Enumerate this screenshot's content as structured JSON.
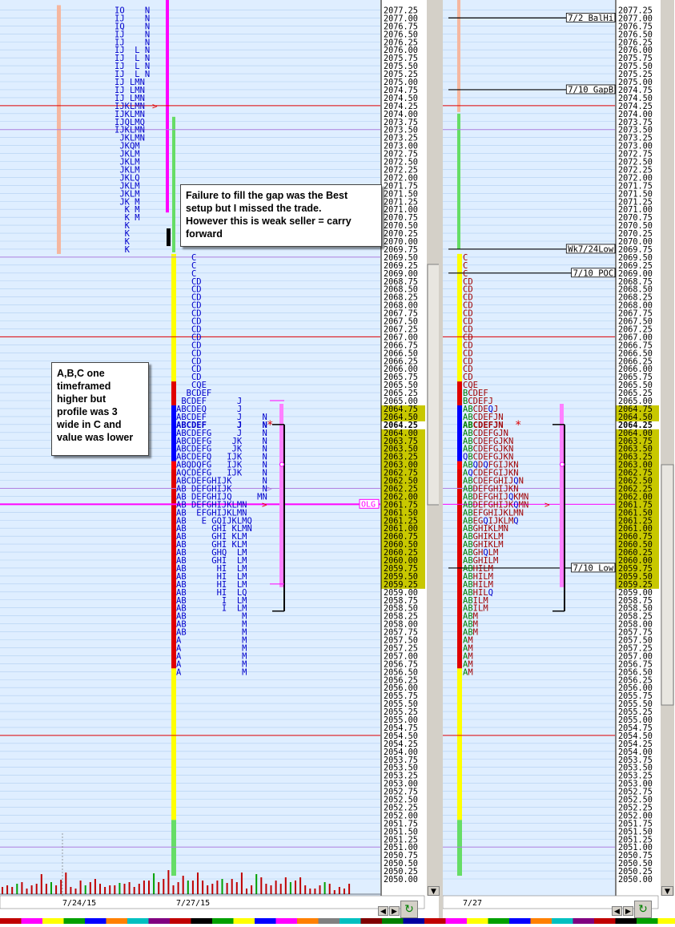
{
  "chart_data": {
    "type": "market-profile",
    "price_axis": {
      "min": 2050.0,
      "max": 2077.25,
      "tick": 0.25,
      "highlight": 2064.25,
      "value_area": [
        2059.25,
        2064.75
      ]
    },
    "left_panel": {
      "date_labels": [
        "7/24/15",
        "7/27/15"
      ],
      "overlay_label": "OLG",
      "prior_day_profile": [
        {
          "p": 2077.25,
          "s": "IO    N"
        },
        {
          "p": 2077.0,
          "s": "IJ    N"
        },
        {
          "p": 2076.75,
          "s": "IQ    N"
        },
        {
          "p": 2076.5,
          "s": "IJ    N"
        },
        {
          "p": 2076.25,
          "s": "IJ    N"
        },
        {
          "p": 2076.0,
          "s": "IJ  L N"
        },
        {
          "p": 2075.75,
          "s": "IJ  L N"
        },
        {
          "p": 2075.5,
          "s": "IJ  L N"
        },
        {
          "p": 2075.25,
          "s": "IJ  L N"
        },
        {
          "p": 2075.0,
          "s": "IJ LMN"
        },
        {
          "p": 2074.75,
          "s": "IJ LMN"
        },
        {
          "p": 2074.5,
          "s": "IJ LMN"
        },
        {
          "p": 2074.25,
          "s": "IJKLMN"
        },
        {
          "p": 2074.0,
          "s": "IJKLMN"
        },
        {
          "p": 2073.75,
          "s": "IJQLMQ"
        },
        {
          "p": 2073.5,
          "s": "IJKLMN"
        },
        {
          "p": 2073.25,
          "s": " JKLMN"
        },
        {
          "p": 2073.0,
          "s": " JKQM"
        },
        {
          "p": 2072.75,
          "s": " JKLM"
        },
        {
          "p": 2072.5,
          "s": " JKLM"
        },
        {
          "p": 2072.25,
          "s": " JKLM"
        },
        {
          "p": 2072.0,
          "s": " JKLQ"
        },
        {
          "p": 2071.75,
          "s": " JKLM"
        },
        {
          "p": 2071.5,
          "s": " JKLM"
        },
        {
          "p": 2071.25,
          "s": " JK M"
        },
        {
          "p": 2071.0,
          "s": "  K M"
        },
        {
          "p": 2070.75,
          "s": "  K M"
        },
        {
          "p": 2070.5,
          "s": "  K"
        },
        {
          "p": 2070.25,
          "s": "  K"
        },
        {
          "p": 2070.0,
          "s": "  K"
        },
        {
          "p": 2069.75,
          "s": "  K"
        }
      ],
      "profile": [
        {
          "p": 2069.5,
          "s": "   C"
        },
        {
          "p": 2069.25,
          "s": "   C"
        },
        {
          "p": 2069.0,
          "s": "   C"
        },
        {
          "p": 2068.75,
          "s": "   CD"
        },
        {
          "p": 2068.5,
          "s": "   CD"
        },
        {
          "p": 2068.25,
          "s": "   CD"
        },
        {
          "p": 2068.0,
          "s": "   CD"
        },
        {
          "p": 2067.75,
          "s": "   CD"
        },
        {
          "p": 2067.5,
          "s": "   CD"
        },
        {
          "p": 2067.25,
          "s": "   CD"
        },
        {
          "p": 2067.0,
          "s": "   CD"
        },
        {
          "p": 2066.75,
          "s": "   CD"
        },
        {
          "p": 2066.5,
          "s": "   CD"
        },
        {
          "p": 2066.25,
          "s": "   CD"
        },
        {
          "p": 2066.0,
          "s": "   CD"
        },
        {
          "p": 2065.75,
          "s": "   CD"
        },
        {
          "p": 2065.5,
          "s": "   CQE"
        },
        {
          "p": 2065.25,
          "s": "  BCDEF"
        },
        {
          "p": 2065.0,
          "s": " BCDEF      J"
        },
        {
          "p": 2064.75,
          "s": "ABCDEQ      J"
        },
        {
          "p": 2064.5,
          "s": "ABCDEF      J    N"
        },
        {
          "p": 2064.25,
          "s": "ABCDEF      J    N"
        },
        {
          "p": 2064.0,
          "s": "ABCDEFG     J    N"
        },
        {
          "p": 2063.75,
          "s": "ABCDEFG    JK    N"
        },
        {
          "p": 2063.5,
          "s": "ABCDEFG    JK    N"
        },
        {
          "p": 2063.25,
          "s": "ABCDEFQ   IJK    N"
        },
        {
          "p": 2063.0,
          "s": "ABQDQFG   IJK    N"
        },
        {
          "p": 2062.75,
          "s": "AQCDEFG   IJK    N"
        },
        {
          "p": 2062.5,
          "s": "ABCDEFGHIJK      N"
        },
        {
          "p": 2062.25,
          "s": "AB DEFGHIJK      N"
        },
        {
          "p": 2062.0,
          "s": "AB DEFGHIJQ     MN"
        },
        {
          "p": 2061.75,
          "s": "AB DEFGHIJKLMN"
        },
        {
          "p": 2061.5,
          "s": "AB  EFGHIJKLMN"
        },
        {
          "p": 2061.25,
          "s": "AB   E GQIJKLMQ"
        },
        {
          "p": 2061.0,
          "s": "AB     GHI KLMN"
        },
        {
          "p": 2060.75,
          "s": "AB     GHI KLM"
        },
        {
          "p": 2060.5,
          "s": "AB     GHI KLM"
        },
        {
          "p": 2060.25,
          "s": "AB     GHQ  LM"
        },
        {
          "p": 2060.0,
          "s": "AB     GHI  LM"
        },
        {
          "p": 2059.75,
          "s": "AB      HI  LM"
        },
        {
          "p": 2059.5,
          "s": "AB      HI  LM"
        },
        {
          "p": 2059.25,
          "s": "AB      HI  LM"
        },
        {
          "p": 2059.0,
          "s": "AB      HI  LQ"
        },
        {
          "p": 2058.75,
          "s": "AB       I  LM"
        },
        {
          "p": 2058.5,
          "s": "AB       I  LM"
        },
        {
          "p": 2058.25,
          "s": "AB           M"
        },
        {
          "p": 2058.0,
          "s": "AB           M"
        },
        {
          "p": 2057.75,
          "s": "AB           M"
        },
        {
          "p": 2057.5,
          "s": "A            M"
        },
        {
          "p": 2057.25,
          "s": "A            M"
        },
        {
          "p": 2057.0,
          "s": "A            M"
        },
        {
          "p": 2056.75,
          "s": "A            M"
        },
        {
          "p": 2056.5,
          "s": "A            M"
        }
      ]
    },
    "right_panel": {
      "date_labels": [
        "7/27"
      ],
      "reference_labels": [
        {
          "p": 2077.0,
          "t": "7/2 BalHi"
        },
        {
          "p": 2074.75,
          "t": "7/10 GapB"
        },
        {
          "p": 2069.75,
          "t": "Wk7/24Low"
        },
        {
          "p": 2069.0,
          "t": "7/10 POC"
        },
        {
          "p": 2059.75,
          "t": "7/10 Low"
        }
      ],
      "profile": [
        {
          "p": 2069.5,
          "s": "C"
        },
        {
          "p": 2069.25,
          "s": "C"
        },
        {
          "p": 2069.0,
          "s": "C"
        },
        {
          "p": 2068.75,
          "s": "CD"
        },
        {
          "p": 2068.5,
          "s": "CD"
        },
        {
          "p": 2068.25,
          "s": "CD"
        },
        {
          "p": 2068.0,
          "s": "CD"
        },
        {
          "p": 2067.75,
          "s": "CD"
        },
        {
          "p": 2067.5,
          "s": "CD"
        },
        {
          "p": 2067.25,
          "s": "CD"
        },
        {
          "p": 2067.0,
          "s": "CD"
        },
        {
          "p": 2066.75,
          "s": "CD"
        },
        {
          "p": 2066.5,
          "s": "CD"
        },
        {
          "p": 2066.25,
          "s": "CD"
        },
        {
          "p": 2066.0,
          "s": "CD"
        },
        {
          "p": 2065.75,
          "s": "CD"
        },
        {
          "p": 2065.5,
          "s": "CQE"
        },
        {
          "p": 2065.25,
          "s": "BCDEF"
        },
        {
          "p": 2065.0,
          "s": "BCDEFJ"
        },
        {
          "p": 2064.75,
          "s": "ABCDEQJ"
        },
        {
          "p": 2064.5,
          "s": "ABCDEFJN"
        },
        {
          "p": 2064.25,
          "s": "ABCDEFJN"
        },
        {
          "p": 2064.0,
          "s": "ABCDEFGJN"
        },
        {
          "p": 2063.75,
          "s": "ABCDEFGJKN"
        },
        {
          "p": 2063.5,
          "s": "ABCDEFGJKN"
        },
        {
          "p": 2063.25,
          "s": "QBCDEFGJKN"
        },
        {
          "p": 2063.0,
          "s": "ABQDQFGIJKN"
        },
        {
          "p": 2062.75,
          "s": "AQCDEFGIJKN"
        },
        {
          "p": 2062.5,
          "s": "ABCDEFGHIJQN"
        },
        {
          "p": 2062.25,
          "s": "ABDEFGHIJKN"
        },
        {
          "p": 2062.0,
          "s": "ABDEFGHIJQKMN"
        },
        {
          "p": 2061.75,
          "s": "ABDEFGHIJKQMN"
        },
        {
          "p": 2061.5,
          "s": "ABEFGHIJKLMN"
        },
        {
          "p": 2061.25,
          "s": "ABEGQIJKLMQ"
        },
        {
          "p": 2061.0,
          "s": "ABGHIKLMN"
        },
        {
          "p": 2060.75,
          "s": "ABGHIKLM"
        },
        {
          "p": 2060.5,
          "s": "ABGHIKLM"
        },
        {
          "p": 2060.25,
          "s": "ABGHQLM"
        },
        {
          "p": 2060.0,
          "s": "ABGHILM"
        },
        {
          "p": 2059.75,
          "s": "ABHILM"
        },
        {
          "p": 2059.5,
          "s": "ABHILM"
        },
        {
          "p": 2059.25,
          "s": "ABHILM"
        },
        {
          "p": 2059.0,
          "s": "ABHILQ"
        },
        {
          "p": 2058.75,
          "s": "ABILM"
        },
        {
          "p": 2058.5,
          "s": "ABILM"
        },
        {
          "p": 2058.25,
          "s": "ABM"
        },
        {
          "p": 2058.0,
          "s": "ABM"
        },
        {
          "p": 2057.75,
          "s": "ABM"
        },
        {
          "p": 2057.5,
          "s": "AM"
        },
        {
          "p": 2057.25,
          "s": "AM"
        },
        {
          "p": 2057.0,
          "s": "AM"
        },
        {
          "p": 2056.75,
          "s": "AM"
        },
        {
          "p": 2056.5,
          "s": "AM"
        }
      ]
    },
    "annotations": [
      "Failure to fill the gap was the Best setup but I missed the trade. However this is weak seller = carry forward",
      "A,B,C one timeframed higher but profile was 3 wide in C and value was lower"
    ],
    "colors": {
      "background": "#dfeeff",
      "grid": "#b0cff0",
      "letters": "#0000cc",
      "value_area": "#c8c800",
      "value_area_text_bg": "#d8d800",
      "poc": "#ff00ff",
      "vpoc_red": "#e00000"
    }
  },
  "annotations": {
    "gap_note": [
      "Failure to fill the gap was the Best",
      "setup but I missed the trade.",
      "However this is weak seller = carry",
      "forward"
    ],
    "abc_note": [
      "A,B,C one",
      "timeframed",
      "higher but",
      "profile was 3",
      "wide in C and",
      "value was lower"
    ]
  }
}
